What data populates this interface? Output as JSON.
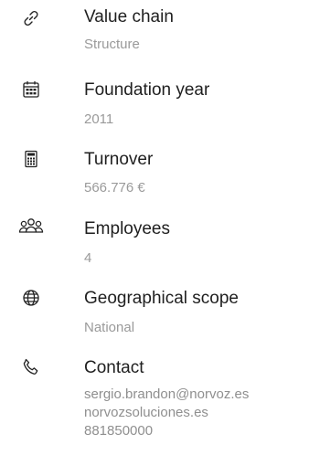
{
  "items": [
    {
      "icon": "link-icon",
      "title": "Value chain",
      "value": "Structure"
    },
    {
      "icon": "calendar-icon",
      "title": "Foundation year",
      "value": "2011"
    },
    {
      "icon": "calculator-icon",
      "title": "Turnover",
      "value": "566.776 €"
    },
    {
      "icon": "people-icon",
      "title": "Employees",
      "value": "4"
    },
    {
      "icon": "globe-icon",
      "title": "Geographical scope",
      "value": "National"
    },
    {
      "icon": "phone-icon",
      "title": "Contact",
      "value": ""
    }
  ],
  "contact": {
    "email": "sergio.brandon@norvoz.es",
    "website": "norvozsoluciones.es",
    "phone": "881850000"
  }
}
